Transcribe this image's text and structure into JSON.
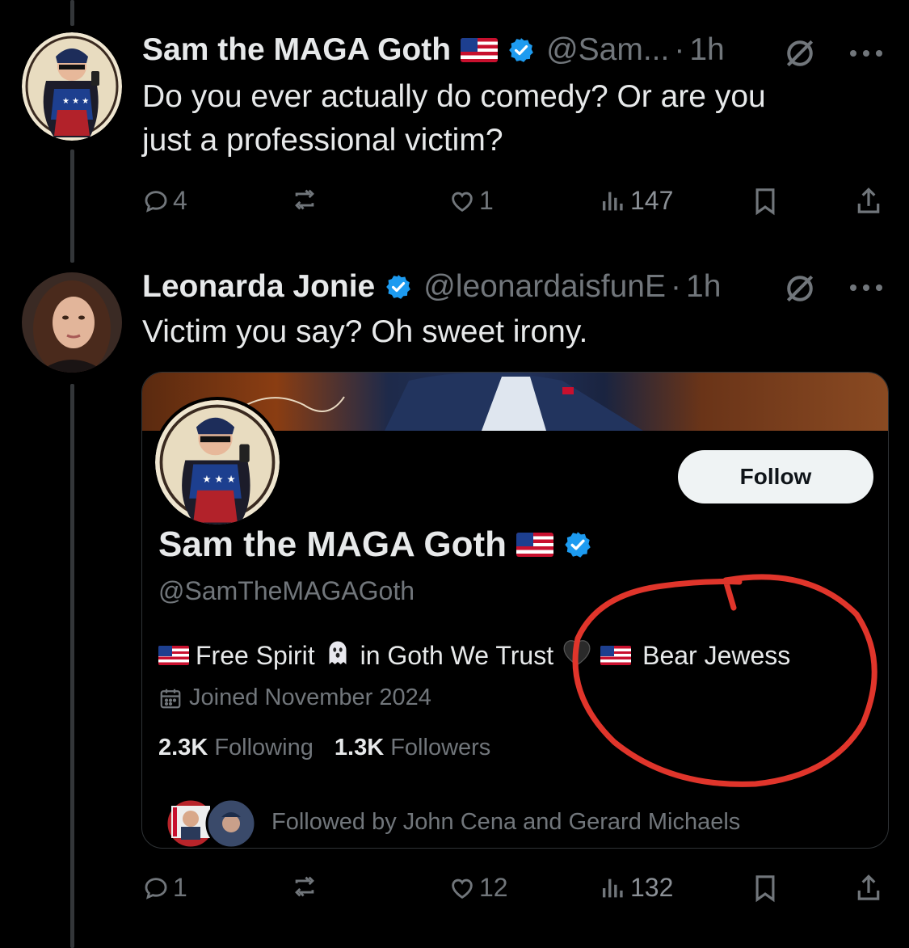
{
  "tweet1": {
    "display_name": "Sam the MAGA Goth",
    "handle": "@Sam...",
    "dot": "·",
    "time": "1h",
    "text_line1": "Do you ever actually do comedy? Or are you",
    "text_line2": "just a professional victim?",
    "replies": "4",
    "likes": "1",
    "views": "147"
  },
  "tweet2": {
    "display_name": "Leonarda Jonie",
    "handle": "@leonardaisfunE",
    "dot": "·",
    "time": "1h",
    "text": "Victim you say? Oh sweet irony.",
    "replies": "1",
    "likes": "12",
    "views": "132"
  },
  "profile_card": {
    "display_name": "Sam the MAGA Goth",
    "handle": "@SamTheMAGAGoth",
    "follow_label": "Follow",
    "bio_part1": "Free Spirit",
    "bio_part2": "in Goth We Trust",
    "bio_part3": "Bear Jewess",
    "joined": "Joined November 2024",
    "following_count": "2.3K",
    "following_label": "Following",
    "followers_count": "1.3K",
    "followers_label": "Followers",
    "followed_by": "Followed by John Cena and Gerard Michaels"
  },
  "colors": {
    "background": "#000000",
    "text_primary": "#e7e9ea",
    "text_secondary": "#71767b",
    "verified_blue": "#1d9bf0",
    "annotation_red": "#e0352b"
  },
  "icons": [
    "reply-icon",
    "repost-icon",
    "like-icon",
    "views-icon",
    "bookmark-icon",
    "share-icon",
    "grok-icon",
    "more-icon",
    "verified-icon",
    "calendar-icon",
    "ghost-emoji",
    "black-heart-emoji",
    "us-flag-emoji"
  ]
}
